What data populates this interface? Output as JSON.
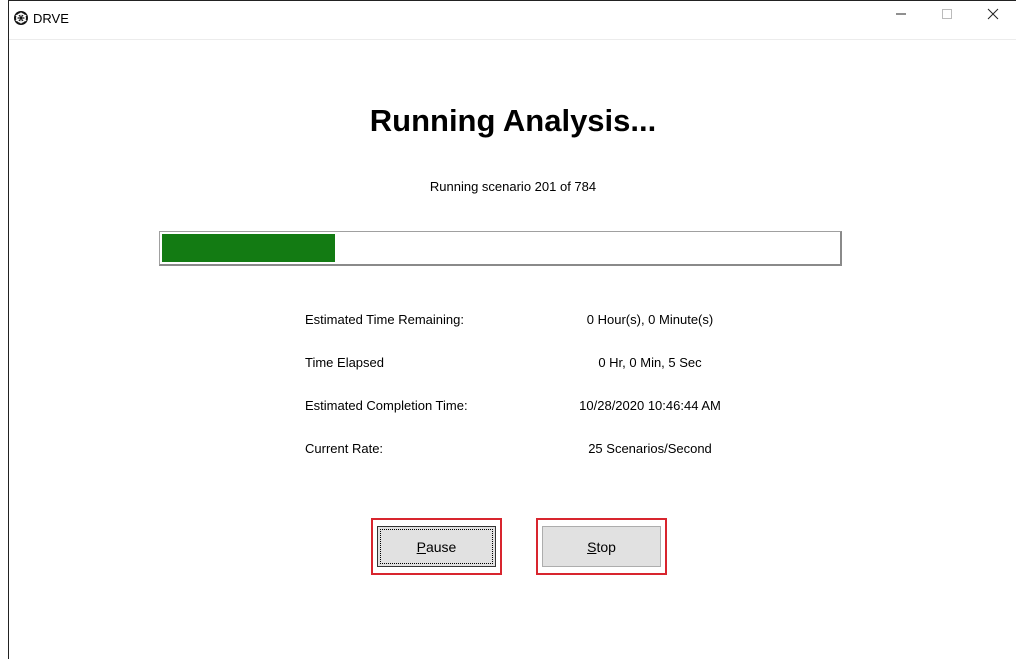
{
  "window": {
    "title": "DRVE",
    "app_icon": "drve-logo-icon",
    "controls": [
      "minimize-icon",
      "maximize-icon",
      "close-icon"
    ]
  },
  "main": {
    "heading": "Running Analysis...",
    "status_text": "Running scenario 201 of 784",
    "progress": {
      "current": 201,
      "total": 784,
      "fraction": 0.256,
      "fill_color": "#137b13"
    },
    "info": [
      {
        "label": "Estimated Time Remaining:",
        "value": "0 Hour(s), 0 Minute(s)"
      },
      {
        "label": "Time Elapsed",
        "value": "0 Hr, 0 Min, 5 Sec"
      },
      {
        "label": "Estimated Completion Time:",
        "value": "10/28/2020 10:46:44 AM"
      },
      {
        "label": "Current Rate:",
        "value": "25 Scenarios/Second"
      }
    ]
  },
  "buttons": {
    "pause": {
      "mnemonic": "P",
      "rest": "ause"
    },
    "stop": {
      "mnemonic": "S",
      "rest": "top"
    },
    "highlight_color": "#d8252e"
  }
}
